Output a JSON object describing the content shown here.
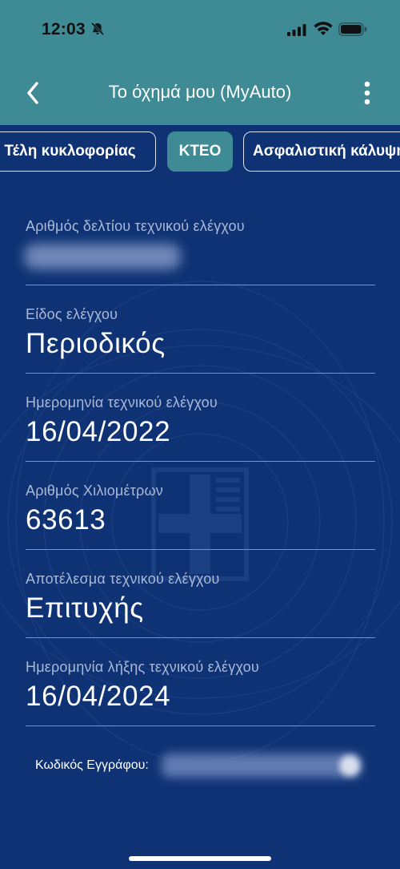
{
  "status_bar": {
    "time": "12:03",
    "icons": [
      "bell-slash-icon",
      "signal-icon",
      "wifi-icon",
      "battery-icon"
    ]
  },
  "nav": {
    "title": "Το όχημά μου (MyAuto)",
    "back_icon": "chevron-left-icon",
    "more_icon": "more-vertical-icon"
  },
  "tabs": [
    {
      "label": "Τέλη κυκλοφορίας",
      "active": false
    },
    {
      "label": "ΚΤΕΟ",
      "active": true
    },
    {
      "label": "Ασφαλιστική κάλυψη",
      "active": false
    }
  ],
  "fields": [
    {
      "label": "Αριθμός δελτίου τεχνικού ελέγχου",
      "value": ""
    },
    {
      "label": "Είδος ελέγχου",
      "value": "Περιοδικός"
    },
    {
      "label": "Ημερομηνία τεχνικού ελέγχου",
      "value": "16/04/2022"
    },
    {
      "label": "Αριθμός Χιλιομέτρων",
      "value": "63613"
    },
    {
      "label": "Αποτέλεσμα τεχνικού ελέγχου",
      "value": "Επιτυχής"
    },
    {
      "label": "Ημερομηνία λήξης τεχνικού ελέγχου",
      "value": "16/04/2024"
    }
  ],
  "document_code": {
    "label": "Κωδικός Εγγράφου:",
    "value": ""
  },
  "colors": {
    "header": "#3e8a95",
    "background": "#0e3274",
    "active_tab": "#3e8a95",
    "label": "#a9b9d6",
    "value": "#ffffff"
  }
}
